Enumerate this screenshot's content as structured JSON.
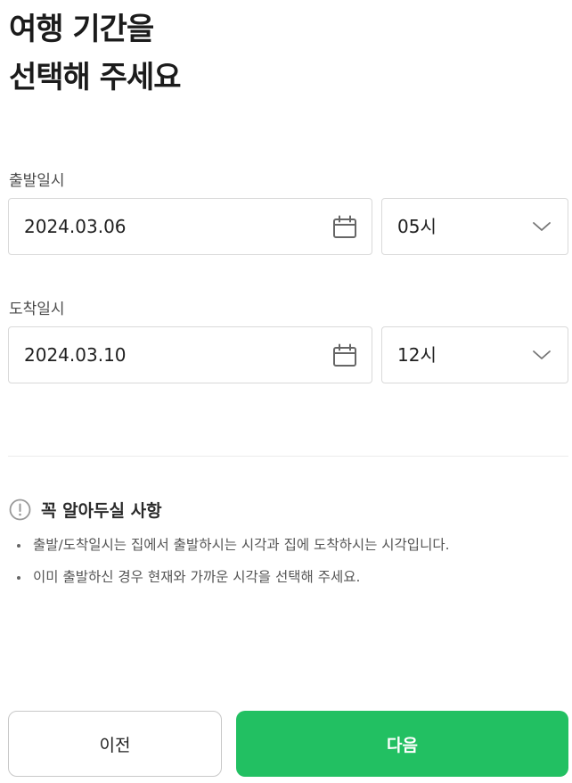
{
  "title": {
    "line1": "여행 기간을",
    "line2": "선택해 주세요"
  },
  "departure": {
    "label": "출발일시",
    "date": "2024.03.06",
    "hour": "05시",
    "date_icon": "calendar-icon",
    "hour_icon": "chevron-down-icon"
  },
  "arrival": {
    "label": "도착일시",
    "date": "2024.03.10",
    "hour": "12시",
    "date_icon": "calendar-icon",
    "hour_icon": "chevron-down-icon"
  },
  "notice": {
    "icon": "info-circle-icon",
    "heading": "꼭 알아두실 사항",
    "items": [
      "출발/도착일시는 집에서 출발하시는 시각과 집에 도착하시는 시각입니다.",
      "이미 출발하신 경우 현재와 가까운 시각을 선택해 주세요."
    ]
  },
  "buttons": {
    "prev": "이전",
    "next": "다음"
  },
  "colors": {
    "primary": "#22c062",
    "border": "#d9d9d9",
    "icon": "#666666"
  }
}
